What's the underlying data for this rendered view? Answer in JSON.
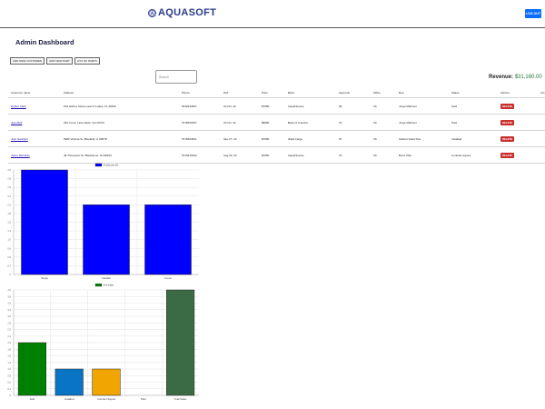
{
  "header": {
    "brand_logo": "Ⓐ",
    "brand_name": "AQUASOFT",
    "logout_label": "LOG OUT"
  },
  "page_title": "Admin Dashboard",
  "actions": [
    "ADD NEW CUSTOMER",
    "ADD NEW PART",
    "LIST OF PARTS"
  ],
  "search": {
    "placeholder": "Search"
  },
  "revenue": {
    "label": "Revenue:",
    "value": "$31,160.00"
  },
  "table": {
    "columns": [
      "Customer name",
      "Address",
      "Phone",
      "DOI",
      "Price",
      "Bank",
      "Approval",
      "Office",
      "Rep",
      "Status",
      "Actions",
      "Cre"
    ],
    "rows": [
      {
        "name": "Robert Clark",
        "address": "100 Harbor Street Land O Lakes, FL 34639",
        "phone": "8132234567",
        "doi": "Oct 04, 22",
        "price": "$7680",
        "bank": "AquaFinance",
        "approval": "99",
        "office": "VA",
        "rep": "Jorge Martinez",
        "status": "Sold",
        "action": "DELETE"
      },
      {
        "name": "Juan Bell",
        "address": "344 Yuvon Lane Dade. GA 30723",
        "phone": "5718453467",
        "doi": "Oct 01, 22",
        "price": "$8080",
        "bank": "Bank of America",
        "approval": "79",
        "office": "VA",
        "rep": "Jorge Martinez",
        "status": "Sold",
        "action": "DELETE"
      },
      {
        "name": "Jose Sanchez",
        "address": "5906 Victoria St. Bluefield, IL 60578",
        "phone": "5716523521",
        "doi": "Sep 27, 22",
        "price": "$7680",
        "bank": "Wells Fargo",
        "approval": "97",
        "office": "VA",
        "rep": "Gabriel Velas Rus",
        "status": "Installed",
        "action": "DELETE"
      },
      {
        "name": "Javier Richards",
        "address": "48 Thompson St. Blackstone, NJ 08103",
        "phone": "5716976432",
        "doi": "Aug 02, 22",
        "price": "$7680",
        "bank": "AquaFinance",
        "approval": "79",
        "office": "VA",
        "rep": "Brent Tiller",
        "status": "Contract signed",
        "action": "DELETE"
      }
    ]
  },
  "chart_data": [
    {
      "type": "bar",
      "categories": [
        "Single",
        "Satellite",
        "Panel"
      ],
      "series": [
        {
          "name": "# units per tier",
          "values": [
            3,
            2,
            2
          ]
        }
      ],
      "ylim": [
        0,
        3
      ],
      "yticks": [
        "0",
        "0.3",
        "0.5",
        "0.8",
        "1.0",
        "1.3",
        "1.5",
        "1.8",
        "2.0",
        "2.3",
        "2.5",
        "2.8",
        "3.0"
      ],
      "legend": "top-center",
      "grid": true,
      "colors": [
        "#0000ff"
      ]
    },
    {
      "type": "bar",
      "categories": [
        "Sold",
        "Installed",
        "Contract Signed",
        "Paid",
        "Total Sales"
      ],
      "series": [
        {
          "name": "# of sales",
          "values": [
            2,
            1,
            1,
            0,
            4
          ]
        }
      ],
      "ylim": [
        0,
        4
      ],
      "yticks": [
        "0",
        "0.3",
        "0.5",
        "0.8",
        "1.0",
        "1.3",
        "1.5",
        "1.8",
        "2.0",
        "2.3",
        "2.5",
        "2.8",
        "3.0",
        "3.3",
        "3.5",
        "3.8",
        "4.0"
      ],
      "legend": "top-center",
      "grid": true,
      "colors": [
        "#008000",
        "#0a74c4",
        "#f0a500",
        "#999999",
        "#3b6b45"
      ]
    }
  ]
}
